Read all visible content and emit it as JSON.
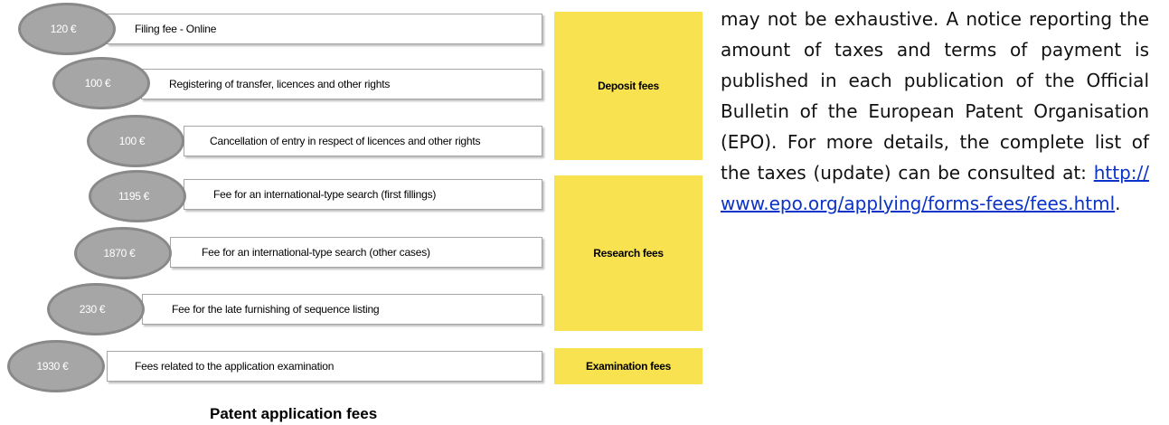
{
  "fees": [
    {
      "amount": "120 €",
      "label": "Filing fee - Online"
    },
    {
      "amount": "100 €",
      "label": "Registering of transfer, licences and other rights"
    },
    {
      "amount": "100 €",
      "label": "Cancellation of entry in respect of licences and other rights"
    },
    {
      "amount": "1195 €",
      "label": "Fee for an international-type search (first fillings)"
    },
    {
      "amount": "1870 €",
      "label": "Fee for an international-type search (other cases)"
    },
    {
      "amount": "230 €",
      "label": "Fee for the late furnishing of sequence listing"
    },
    {
      "amount": "1930 €",
      "label": "Fees related to the application examination"
    }
  ],
  "categories": {
    "deposit": "Deposit fees",
    "research": "Research fees",
    "examination": "Examination fees"
  },
  "caption": "Patent application fees",
  "paragraph": {
    "text": "may not be exhaustive. A notice reporting the amount of taxes and terms of payment is published in each publication of the Official Bulletin of the European Patent Organisation (EPO). For more details, the complete list of the taxes (update) can be consulted at: ",
    "link": "http://www.epo.org/applying/forms-fees/fees.html",
    "end": "."
  },
  "colors": {
    "category_fill": "#f9e24f",
    "amount_fill": "#a6a6a6",
    "link": "#0b33c7"
  }
}
